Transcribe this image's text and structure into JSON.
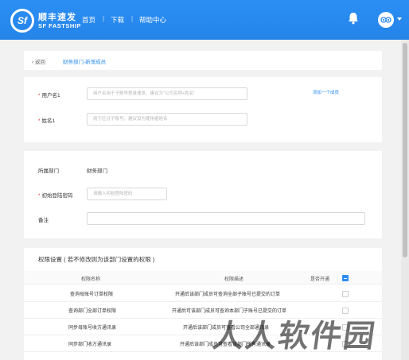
{
  "header": {
    "logo_text": "Sf",
    "brand_cn": "顺丰速发",
    "brand_en": "SF FASTSHIP",
    "nav": [
      "首页",
      "下载",
      "帮助中心"
    ],
    "nav_separator": "|",
    "accent_color": "#2d8cf0"
  },
  "breadcrumb": {
    "back_label": "返回",
    "path": "财务部门-新增成员"
  },
  "form": {
    "username": {
      "label": "用户名1",
      "placeholder": "用户名用于子账号登录速发，建议为\"公司名称+姓名\""
    },
    "add_member_link": "添加一个成员",
    "name": {
      "label": "姓名1",
      "placeholder": "用于区分子账号，建议设为使用者姓名"
    },
    "department": {
      "label": "所属部门",
      "value": "财务部门"
    },
    "password": {
      "label": "初始登陆密码",
      "placeholder": "请输入初始登陆密码"
    },
    "remark": {
      "label": "备注"
    }
  },
  "permissions": {
    "title": "权限设置 ( 若不修改则为该部门设置的权限 )",
    "columns": [
      "权限名称",
      "权限描述",
      "是否开通"
    ],
    "rows": [
      {
        "name": "查询母账号订单权限",
        "desc": "开通后该部门成员可查询全部子账号已提交的订单"
      },
      {
        "name": "查询部门全部订单权限",
        "desc": "开通后可该部门成员可查询本部门子账号已提交的订单"
      },
      {
        "name": "同步母账号收方通讯录",
        "desc": "开通后该部门成员可查看公司全部通讯录"
      },
      {
        "name": "同步部门收方通讯录",
        "desc": "开通后该部门成员可查看该部门所有通讯录"
      }
    ]
  },
  "watermark": "人人软件园"
}
